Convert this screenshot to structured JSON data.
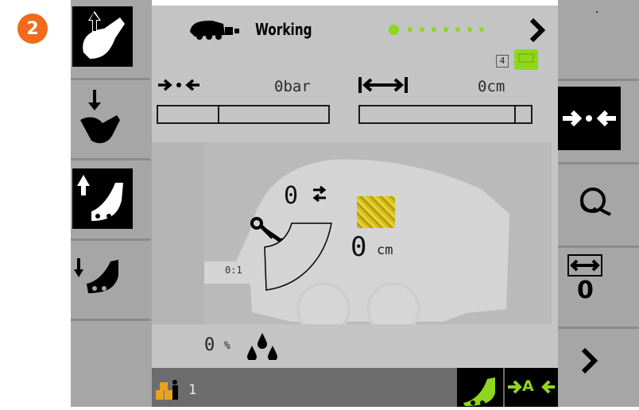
{
  "step_badge": "2",
  "header": {
    "status_text": "Working",
    "page_count": "4"
  },
  "pressure": {
    "value": "0bar",
    "fill_fraction": 0.35
  },
  "distance": {
    "value": "0cm",
    "fill_fraction": 0.9
  },
  "bale": {
    "count": "0",
    "diameter": "0",
    "diameter_unit": "cm",
    "ratio": "0:1"
  },
  "moisture": {
    "value": "0",
    "unit": "%"
  },
  "status_bar": {
    "bale_counter": "1",
    "auto_label": "A"
  },
  "right_panel": {
    "net_width_value": "0"
  },
  "colors": {
    "accent_green": "#8fd61c",
    "badge_orange": "#f26a1b"
  },
  "icons": [
    "raise-tailgate-icon",
    "lower-tailgate-icon",
    "raise-pickup-icon",
    "lower-pickup-icon",
    "compress-icon",
    "net-wrap-icon",
    "width-icon",
    "next-arrow-icon",
    "baler-icon",
    "moisture-drops-icon",
    "bale-stack-icon",
    "pickup-icon",
    "auto-mode-icon"
  ]
}
